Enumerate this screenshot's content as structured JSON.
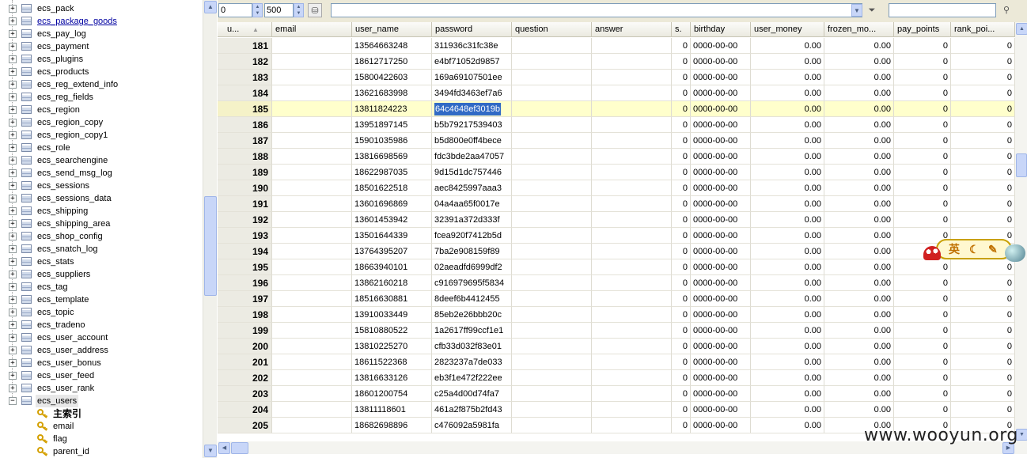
{
  "tree": {
    "tables": [
      {
        "label": "ecs_pack"
      },
      {
        "label": "ecs_package_goods",
        "style": "link"
      },
      {
        "label": "ecs_pay_log"
      },
      {
        "label": "ecs_payment"
      },
      {
        "label": "ecs_plugins"
      },
      {
        "label": "ecs_products"
      },
      {
        "label": "ecs_reg_extend_info"
      },
      {
        "label": "ecs_reg_fields"
      },
      {
        "label": "ecs_region"
      },
      {
        "label": "ecs_region_copy"
      },
      {
        "label": "ecs_region_copy1"
      },
      {
        "label": "ecs_role"
      },
      {
        "label": "ecs_searchengine"
      },
      {
        "label": "ecs_send_msg_log"
      },
      {
        "label": "ecs_sessions"
      },
      {
        "label": "ecs_sessions_data"
      },
      {
        "label": "ecs_shipping"
      },
      {
        "label": "ecs_shipping_area"
      },
      {
        "label": "ecs_shop_config"
      },
      {
        "label": "ecs_snatch_log"
      },
      {
        "label": "ecs_stats"
      },
      {
        "label": "ecs_suppliers"
      },
      {
        "label": "ecs_tag"
      },
      {
        "label": "ecs_template"
      },
      {
        "label": "ecs_topic"
      },
      {
        "label": "ecs_tradeno"
      },
      {
        "label": "ecs_user_account"
      },
      {
        "label": "ecs_user_address"
      },
      {
        "label": "ecs_user_bonus"
      },
      {
        "label": "ecs_user_feed"
      },
      {
        "label": "ecs_user_rank"
      },
      {
        "label": "ecs_users",
        "style": "selected",
        "expanded": true
      }
    ],
    "keys": [
      {
        "label": "主索引",
        "bold": true
      },
      {
        "label": "email"
      },
      {
        "label": "flag"
      },
      {
        "label": "parent_id"
      }
    ]
  },
  "toolbar": {
    "offset_value": "0",
    "limit_value": "500",
    "filter_value": "",
    "search_value": ""
  },
  "grid": {
    "columns": [
      "u...",
      "email",
      "user_name",
      "password",
      "question",
      "answer",
      "s.",
      "birthday",
      "user_money",
      "frozen_mo...",
      "pay_points",
      "rank_poi..."
    ],
    "rows": [
      {
        "id": "181",
        "email": "",
        "user_name": "13564663248",
        "password": "311936c31fc38e",
        "question": "",
        "answer": "",
        "s": "0",
        "birthday": "0000-00-00",
        "user_money": "0.00",
        "frozen": "0.00",
        "pay_points": "0",
        "rank_points": "0"
      },
      {
        "id": "182",
        "email": "",
        "user_name": "18612717250",
        "password": "e4bf71052d9857",
        "question": "",
        "answer": "",
        "s": "0",
        "birthday": "0000-00-00",
        "user_money": "0.00",
        "frozen": "0.00",
        "pay_points": "0",
        "rank_points": "0"
      },
      {
        "id": "183",
        "email": "",
        "user_name": "15800422603",
        "password": "169a69107501ee",
        "question": "",
        "answer": "",
        "s": "0",
        "birthday": "0000-00-00",
        "user_money": "0.00",
        "frozen": "0.00",
        "pay_points": "0",
        "rank_points": "0"
      },
      {
        "id": "184",
        "email": "",
        "user_name": "13621683998",
        "password": "3494fd3463ef7a6",
        "question": "",
        "answer": "",
        "s": "0",
        "birthday": "0000-00-00",
        "user_money": "0.00",
        "frozen": "0.00",
        "pay_points": "0",
        "rank_points": "0"
      },
      {
        "id": "185",
        "email": "",
        "user_name": "13811824223",
        "password": "64c4648ef3019b",
        "question": "",
        "answer": "",
        "s": "0",
        "birthday": "0000-00-00",
        "user_money": "0.00",
        "frozen": "0.00",
        "pay_points": "0",
        "rank_points": "0",
        "highlight": true
      },
      {
        "id": "186",
        "email": "",
        "user_name": "13951897145",
        "password": "b5b79217539403",
        "question": "",
        "answer": "",
        "s": "0",
        "birthday": "0000-00-00",
        "user_money": "0.00",
        "frozen": "0.00",
        "pay_points": "0",
        "rank_points": "0"
      },
      {
        "id": "187",
        "email": "",
        "user_name": "15901035986",
        "password": "b5d800e0ff4bece",
        "question": "",
        "answer": "",
        "s": "0",
        "birthday": "0000-00-00",
        "user_money": "0.00",
        "frozen": "0.00",
        "pay_points": "0",
        "rank_points": "0"
      },
      {
        "id": "188",
        "email": "",
        "user_name": "13816698569",
        "password": "fdc3bde2aa47057",
        "question": "",
        "answer": "",
        "s": "0",
        "birthday": "0000-00-00",
        "user_money": "0.00",
        "frozen": "0.00",
        "pay_points": "0",
        "rank_points": "0"
      },
      {
        "id": "189",
        "email": "",
        "user_name": "18622987035",
        "password": "9d15d1dc757446",
        "question": "",
        "answer": "",
        "s": "0",
        "birthday": "0000-00-00",
        "user_money": "0.00",
        "frozen": "0.00",
        "pay_points": "0",
        "rank_points": "0"
      },
      {
        "id": "190",
        "email": "",
        "user_name": "18501622518",
        "password": "aec8425997aaa3",
        "question": "",
        "answer": "",
        "s": "0",
        "birthday": "0000-00-00",
        "user_money": "0.00",
        "frozen": "0.00",
        "pay_points": "0",
        "rank_points": "0"
      },
      {
        "id": "191",
        "email": "",
        "user_name": "13601696869",
        "password": "04a4aa65f0017e",
        "question": "",
        "answer": "",
        "s": "0",
        "birthday": "0000-00-00",
        "user_money": "0.00",
        "frozen": "0.00",
        "pay_points": "0",
        "rank_points": "0"
      },
      {
        "id": "192",
        "email": "",
        "user_name": "13601453942",
        "password": "32391a372d333f",
        "question": "",
        "answer": "",
        "s": "0",
        "birthday": "0000-00-00",
        "user_money": "0.00",
        "frozen": "0.00",
        "pay_points": "0",
        "rank_points": "0"
      },
      {
        "id": "193",
        "email": "",
        "user_name": "13501644339",
        "password": "fcea920f7412b5d",
        "question": "",
        "answer": "",
        "s": "0",
        "birthday": "0000-00-00",
        "user_money": "0.00",
        "frozen": "0.00",
        "pay_points": "0",
        "rank_points": "0"
      },
      {
        "id": "194",
        "email": "",
        "user_name": "13764395207",
        "password": "7ba2e908159f89",
        "question": "",
        "answer": "",
        "s": "0",
        "birthday": "0000-00-00",
        "user_money": "0.00",
        "frozen": "0.00",
        "pay_points": "0",
        "rank_points": "0"
      },
      {
        "id": "195",
        "email": "",
        "user_name": "18663940101",
        "password": "02aeadfd6999df2",
        "question": "",
        "answer": "",
        "s": "0",
        "birthday": "0000-00-00",
        "user_money": "0.00",
        "frozen": "0.00",
        "pay_points": "0",
        "rank_points": "0"
      },
      {
        "id": "196",
        "email": "",
        "user_name": "13862160218",
        "password": "c916979695f5834",
        "question": "",
        "answer": "",
        "s": "0",
        "birthday": "0000-00-00",
        "user_money": "0.00",
        "frozen": "0.00",
        "pay_points": "0",
        "rank_points": "0"
      },
      {
        "id": "197",
        "email": "",
        "user_name": "18516630881",
        "password": "8deef6b4412455",
        "question": "",
        "answer": "",
        "s": "0",
        "birthday": "0000-00-00",
        "user_money": "0.00",
        "frozen": "0.00",
        "pay_points": "0",
        "rank_points": "0"
      },
      {
        "id": "198",
        "email": "",
        "user_name": "13910033449",
        "password": "85eb2e26bbb20c",
        "question": "",
        "answer": "",
        "s": "0",
        "birthday": "0000-00-00",
        "user_money": "0.00",
        "frozen": "0.00",
        "pay_points": "0",
        "rank_points": "0"
      },
      {
        "id": "199",
        "email": "",
        "user_name": "15810880522",
        "password": "1a2617ff99ccf1e1",
        "question": "",
        "answer": "",
        "s": "0",
        "birthday": "0000-00-00",
        "user_money": "0.00",
        "frozen": "0.00",
        "pay_points": "0",
        "rank_points": "0"
      },
      {
        "id": "200",
        "email": "",
        "user_name": "13810225270",
        "password": "cfb33d032f83e01",
        "question": "",
        "answer": "",
        "s": "0",
        "birthday": "0000-00-00",
        "user_money": "0.00",
        "frozen": "0.00",
        "pay_points": "0",
        "rank_points": "0"
      },
      {
        "id": "201",
        "email": "",
        "user_name": "18611522368",
        "password": "2823237a7de033",
        "question": "",
        "answer": "",
        "s": "0",
        "birthday": "0000-00-00",
        "user_money": "0.00",
        "frozen": "0.00",
        "pay_points": "0",
        "rank_points": "0"
      },
      {
        "id": "202",
        "email": "",
        "user_name": "13816633126",
        "password": "eb3f1e472f222ee",
        "question": "",
        "answer": "",
        "s": "0",
        "birthday": "0000-00-00",
        "user_money": "0.00",
        "frozen": "0.00",
        "pay_points": "0",
        "rank_points": "0"
      },
      {
        "id": "203",
        "email": "",
        "user_name": "18601200754",
        "password": "c25a4d00d74fa7",
        "question": "",
        "answer": "",
        "s": "0",
        "birthday": "0000-00-00",
        "user_money": "0.00",
        "frozen": "0.00",
        "pay_points": "0",
        "rank_points": "0"
      },
      {
        "id": "204",
        "email": "",
        "user_name": "13811118601",
        "password": "461a2f875b2fd43",
        "question": "",
        "answer": "",
        "s": "0",
        "birthday": "0000-00-00",
        "user_money": "0.00",
        "frozen": "0.00",
        "pay_points": "0",
        "rank_points": "0"
      },
      {
        "id": "205",
        "email": "",
        "user_name": "18682698896",
        "password": "c476092a5981fa",
        "question": "",
        "answer": "",
        "s": "0",
        "birthday": "0000-00-00",
        "user_money": "0.00",
        "frozen": "0.00",
        "pay_points": "0",
        "rank_points": "0"
      }
    ]
  },
  "ime": {
    "lang_char": "英",
    "moon_char": "☾",
    "tool_char": "✎"
  },
  "watermark": "www.wooyun.org",
  "icons": {
    "refresh": "refresh-icon",
    "filter": "funnel-icon",
    "search": "search-icon"
  }
}
